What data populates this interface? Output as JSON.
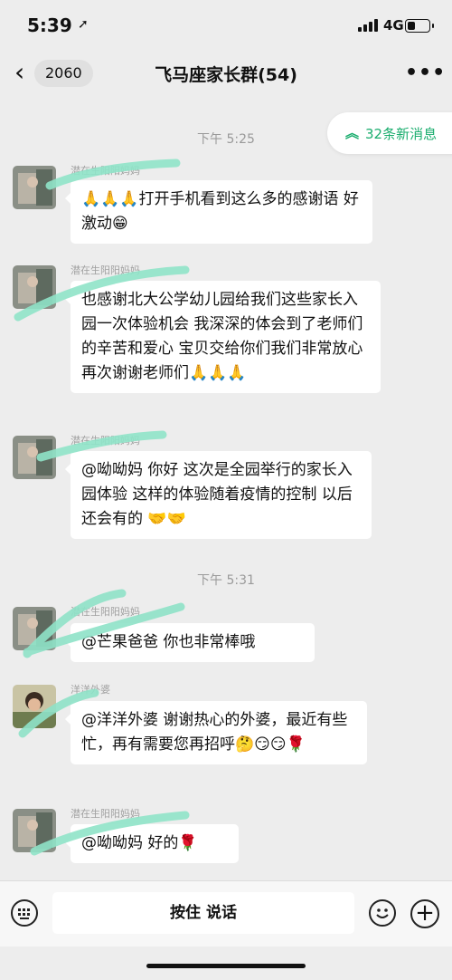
{
  "status_bar": {
    "time": "5:39",
    "network": "4G"
  },
  "nav": {
    "back_count": "2060",
    "title": "飞马座家长群(54)",
    "more": "•••"
  },
  "new_messages": {
    "label": "32条新消息"
  },
  "timestamps": [
    "下午 5:25",
    "下午 5:31"
  ],
  "messages": [
    {
      "sender": "潜在生阳阳妈妈",
      "text": "🙏🙏🙏打开手机看到这么多的感谢语 好激动😁"
    },
    {
      "sender": "潜在生阳阳妈妈",
      "text": "也感谢北大公学幼儿园给我们这些家长入园一次体验机会 我深深的体会到了老师们的辛苦和爱心 宝贝交给你们我们非常放心 再次谢谢老师们🙏🙏🙏"
    },
    {
      "sender": "潜在生阳阳妈妈",
      "text": "@呦呦妈 你好 这次是全园举行的家长入园体验 这样的体验随着疫情的控制 以后还会有的 🤝🤝"
    },
    {
      "sender": "潜在生阳阳妈妈",
      "text": "@芒果爸爸 你也非常棒哦"
    },
    {
      "sender": "洋洋外婆",
      "text": "@洋洋外婆 谢谢热心的外婆，最近有些忙，再有需要您再招呼🤔😏😏🌹"
    },
    {
      "sender": "潜在生阳阳妈妈",
      "text": "@呦呦妈 好的🌹"
    }
  ],
  "input_bar": {
    "talk_label": "按住 说话",
    "plus": "+"
  }
}
